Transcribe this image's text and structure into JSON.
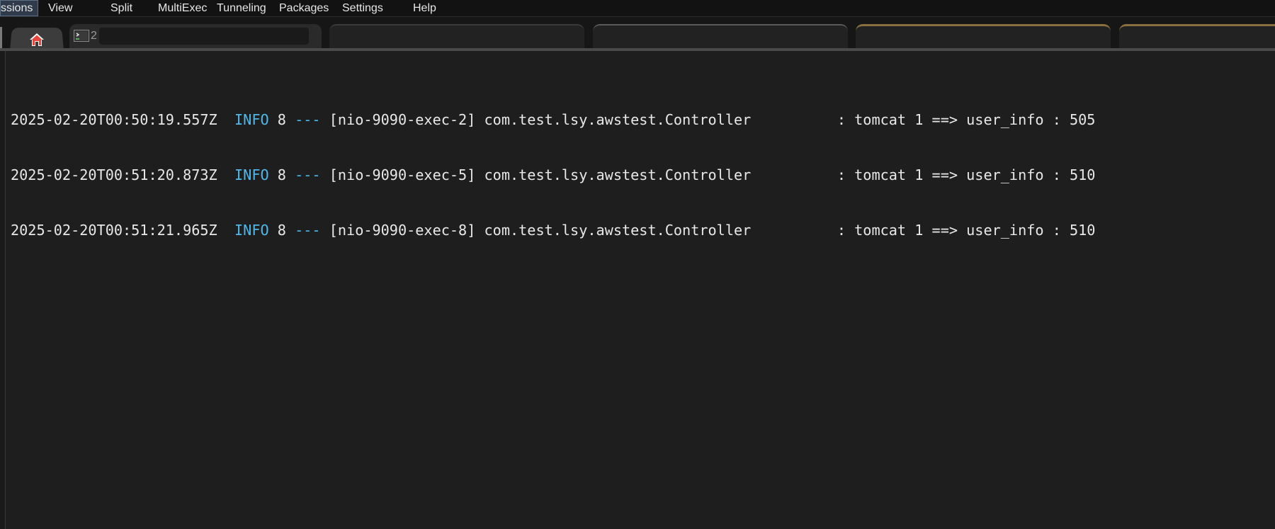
{
  "menubar": {
    "items": [
      {
        "label": "ssions",
        "active": true
      },
      {
        "label": "View"
      },
      {
        "label": "Split"
      },
      {
        "label": "MultiExec"
      },
      {
        "label": "Tunneling"
      },
      {
        "label": "Packages"
      },
      {
        "label": "Settings"
      },
      {
        "label": "Help"
      }
    ]
  },
  "tabs": {
    "home_icon": "home-icon",
    "session_tab": {
      "icon": "terminal-icon",
      "number": "2"
    }
  },
  "colors": {
    "background": "#1e1e1e",
    "level_color": "#4fb8e8",
    "text_color": "#e8e8e8",
    "active_tab_accent": "#8a7040"
  },
  "log": {
    "lines": [
      {
        "timestamp": "2025-02-20T00:50:19.557Z",
        "level": "INFO",
        "pid": "8",
        "sep": "---",
        "thread": "[nio-9090-exec-2]",
        "logger": "com.test.lsy.awstest.Controller",
        "message": ": tomcat 1 ==> user_info : 505"
      },
      {
        "timestamp": "2025-02-20T00:51:20.873Z",
        "level": "INFO",
        "pid": "8",
        "sep": "---",
        "thread": "[nio-9090-exec-5]",
        "logger": "com.test.lsy.awstest.Controller",
        "message": ": tomcat 1 ==> user_info : 510"
      },
      {
        "timestamp": "2025-02-20T00:51:21.965Z",
        "level": "INFO",
        "pid": "8",
        "sep": "---",
        "thread": "[nio-9090-exec-8]",
        "logger": "com.test.lsy.awstest.Controller",
        "message": ": tomcat 1 ==> user_info : 510"
      }
    ]
  }
}
